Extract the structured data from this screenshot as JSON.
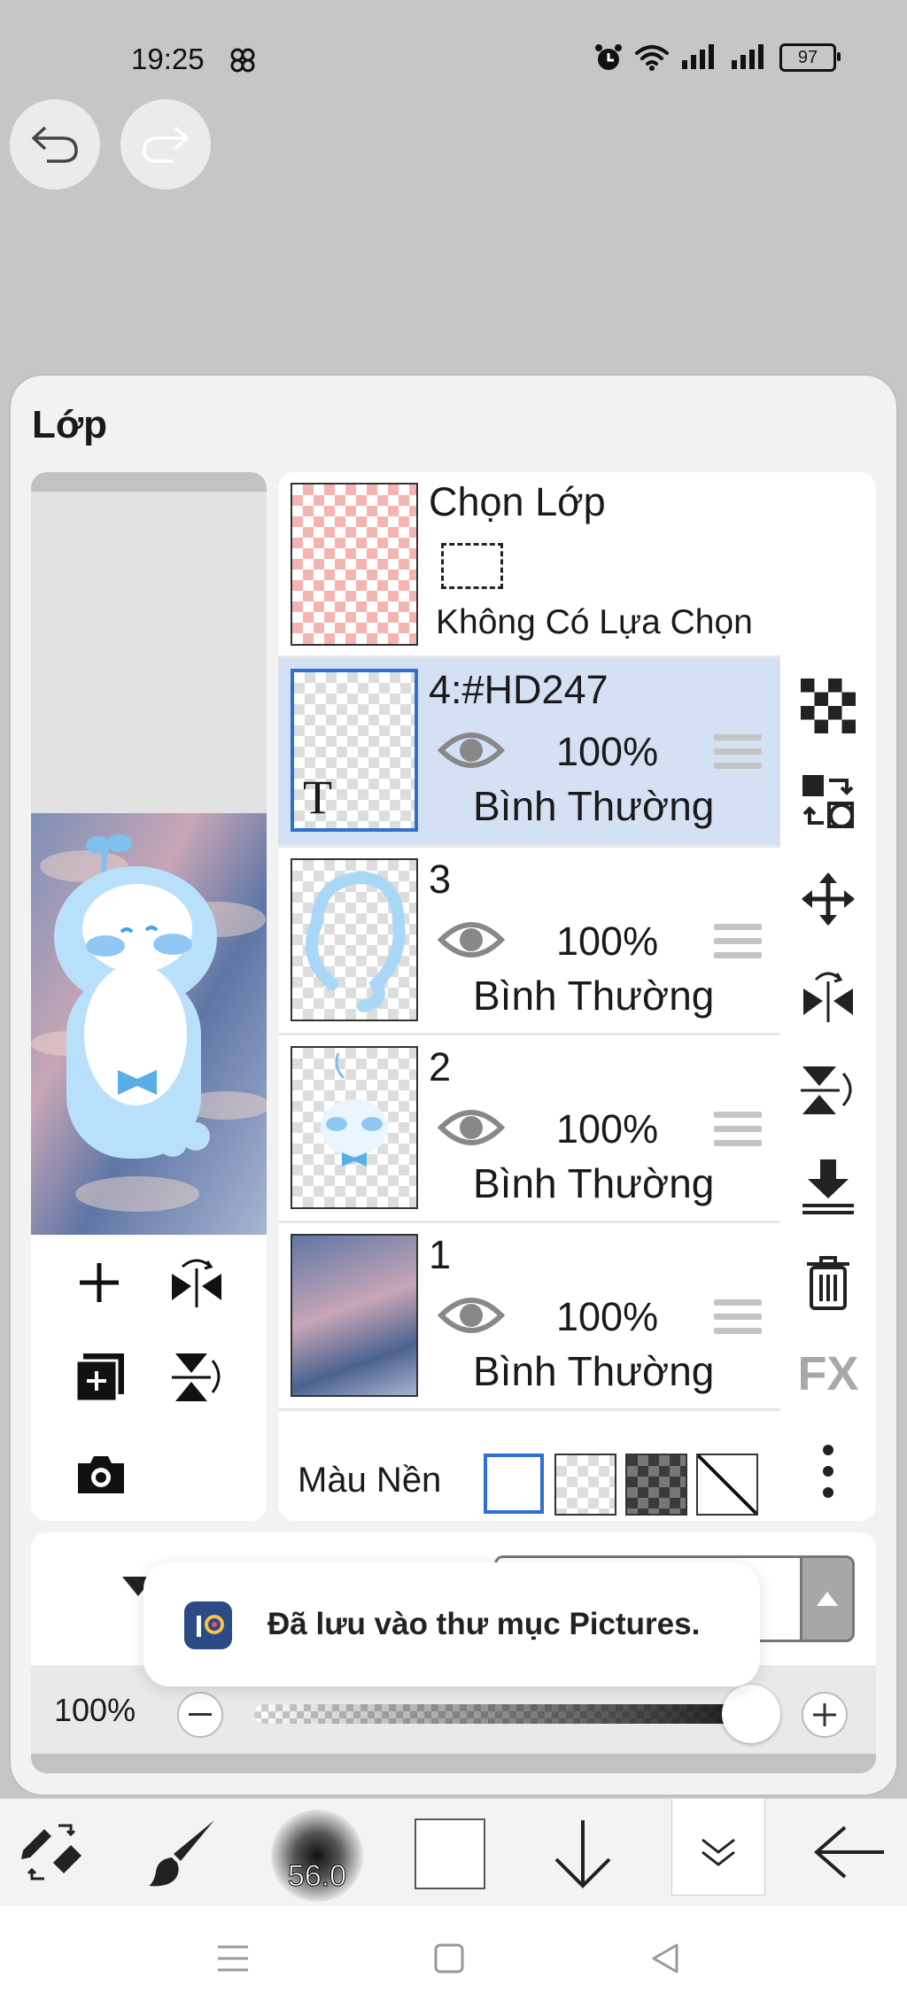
{
  "status_bar": {
    "time": "19:25",
    "battery": "97"
  },
  "panel": {
    "title": "Lớp"
  },
  "selection_layer": {
    "label": "Chọn Lớp",
    "state": "Không Có Lựa Chọn"
  },
  "layers": [
    {
      "name": "4:#HD247",
      "opacity": "100%",
      "blend": "Bình Thường",
      "selected": true
    },
    {
      "name": "3",
      "opacity": "100%",
      "blend": "Bình Thường",
      "selected": false
    },
    {
      "name": "2",
      "opacity": "100%",
      "blend": "Bình Thường",
      "selected": false
    },
    {
      "name": "1",
      "opacity": "100%",
      "blend": "Bình Thường",
      "selected": false
    }
  ],
  "background": {
    "label": "Màu Nền"
  },
  "opacity_slider": {
    "value_label": "100%",
    "value": 1.0
  },
  "toast": {
    "message": "Đã lưu vào thư mục Pictures."
  },
  "toolbar": {
    "brush_size": "56.0"
  },
  "right_tools": {
    "fx_label": "FX"
  },
  "colors": {
    "selected_row": "#d4e0f3",
    "accent": "#2f6fd0",
    "panel": "#f2f2f2",
    "screen_bg": "#c6c6c8"
  },
  "thumb_text": {
    "layer4_glyph": "T"
  }
}
